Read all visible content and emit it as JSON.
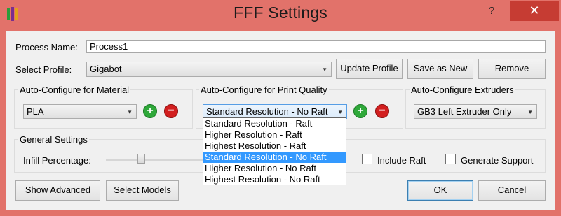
{
  "window": {
    "title": "FFF Settings",
    "help_label": "?",
    "close_label": "✕"
  },
  "process": {
    "name_label": "Process Name:",
    "name_value": "Process1"
  },
  "profile": {
    "label": "Select Profile:",
    "selected": "Gigabot",
    "update_label": "Update Profile",
    "save_as_new_label": "Save as New",
    "remove_label": "Remove"
  },
  "material": {
    "group_title": "Auto-Configure for Material",
    "selected": "PLA"
  },
  "quality": {
    "group_title": "Auto-Configure for Print Quality",
    "selected": "Standard Resolution - No Raft",
    "options": [
      "Standard Resolution - Raft",
      "Higher Resolution - Raft",
      "Highest Resolution - Raft",
      "Standard Resolution - No Raft",
      "Higher Resolution - No Raft",
      "Highest Resolution - No Raft"
    ],
    "highlighted_index": 3
  },
  "extruders": {
    "group_title": "Auto-Configure Extruders",
    "selected": "GB3 Left Extruder Only"
  },
  "general": {
    "group_title": "General Settings",
    "infill_label": "Infill Percentage:",
    "include_raft_label": "Include Raft",
    "include_raft_checked": false,
    "generate_support_label": "Generate Support",
    "generate_support_checked": false
  },
  "footer": {
    "show_advanced_label": "Show Advanced",
    "select_models_label": "Select Models",
    "ok_label": "OK",
    "cancel_label": "Cancel"
  },
  "colors": {
    "frame": "#e2726a",
    "close": "#c63c33",
    "highlight": "#3399ff",
    "add_green": "#2fa83a",
    "remove_red": "#d21f1f"
  },
  "icons": [
    "app-icon",
    "plus-icon",
    "minus-icon",
    "chevron-down-icon",
    "close-icon",
    "help-icon"
  ]
}
